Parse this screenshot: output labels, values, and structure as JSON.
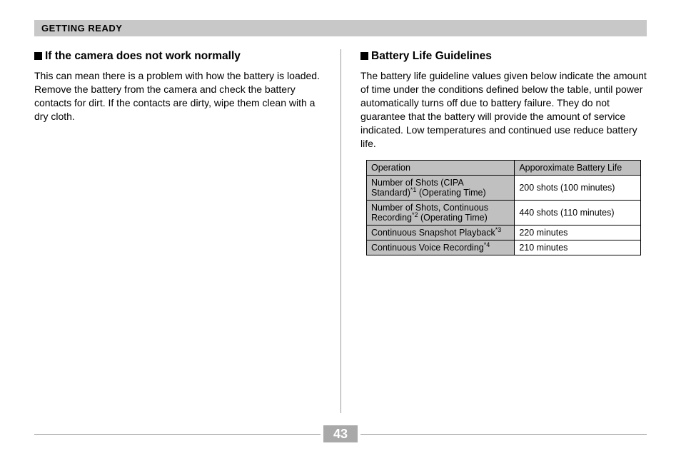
{
  "header": "GETTING READY",
  "left": {
    "heading": "If the camera does not work normally",
    "body": "This can mean there is a problem with how the battery is loaded. Remove the battery from the camera and check the battery contacts for dirt. If the contacts are dirty, wipe them clean with a dry cloth."
  },
  "right": {
    "heading": "Battery Life Guidelines",
    "body": "The battery life guideline values given below indicate the amount of time under the conditions defined below the table, until power automatically turns off due to battery failure. They do not guarantee that the battery will provide the amount of service indicated. Low temperatures and continued use reduce battery life.",
    "table": {
      "head": {
        "col1": "Operation",
        "col2": "Apporoximate Battery Life"
      },
      "rows": [
        {
          "label_pre": "Number of Shots (CIPA Standard)",
          "note": "*1",
          "label_post": " (Operating Time)",
          "value": "200 shots (100 minutes)"
        },
        {
          "label_pre": "Number of Shots, Continuous Recording",
          "note": "*2",
          "label_post": " (Operating Time)",
          "value": "440 shots (110 minutes)"
        },
        {
          "label_pre": "Continuous Snapshot Playback",
          "note": "*3",
          "label_post": "",
          "value": "220 minutes"
        },
        {
          "label_pre": "Continuous Voice Recording",
          "note": "*4",
          "label_post": "",
          "value": "210 minutes"
        }
      ]
    }
  },
  "page_number": "43"
}
